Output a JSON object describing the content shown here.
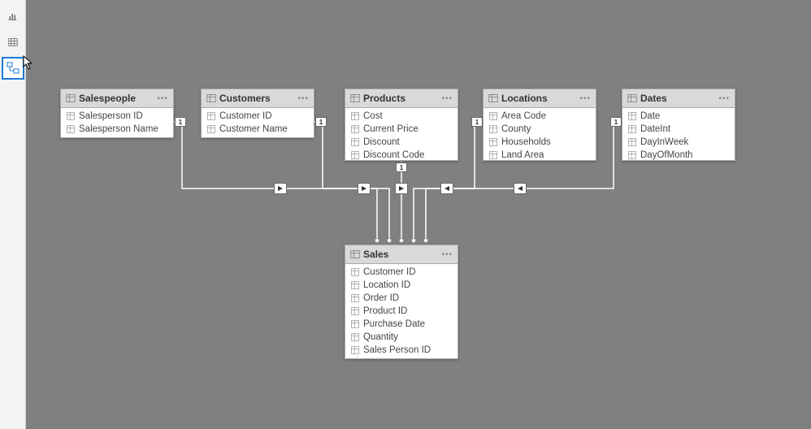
{
  "nav": {
    "items": [
      {
        "name": "report-view",
        "active": false
      },
      {
        "name": "data-view",
        "active": false
      },
      {
        "name": "model-view",
        "active": true
      }
    ]
  },
  "tables": {
    "salespeople": {
      "title": "Salespeople",
      "fields": [
        "Salesperson ID",
        "Salesperson Name"
      ]
    },
    "customers": {
      "title": "Customers",
      "fields": [
        "Customer ID",
        "Customer Name"
      ]
    },
    "products": {
      "title": "Products",
      "fields": [
        "Cost",
        "Current Price",
        "Discount",
        "Discount Code"
      ]
    },
    "locations": {
      "title": "Locations",
      "fields": [
        "Area Code",
        "County",
        "Households",
        "Land Area"
      ]
    },
    "dates": {
      "title": "Dates",
      "fields": [
        "Date",
        "DateInt",
        "DayInWeek",
        "DayOfMonth"
      ]
    },
    "sales": {
      "title": "Sales",
      "fields": [
        "Customer ID",
        "Location ID",
        "Order ID",
        "Product ID",
        "Purchase Date",
        "Quantity",
        "Sales Person ID"
      ]
    }
  },
  "relationships": [
    {
      "from": "salespeople",
      "to": "sales",
      "cardFrom": "1",
      "cardTo": "*"
    },
    {
      "from": "customers",
      "to": "sales",
      "cardFrom": "1",
      "cardTo": "*"
    },
    {
      "from": "products",
      "to": "sales",
      "cardFrom": "1",
      "cardTo": "*"
    },
    {
      "from": "locations",
      "to": "sales",
      "cardFrom": "1",
      "cardTo": "*"
    },
    {
      "from": "dates",
      "to": "sales",
      "cardFrom": "1",
      "cardTo": "*"
    }
  ],
  "cardinality_labels": {
    "one": "1",
    "many": "*"
  }
}
